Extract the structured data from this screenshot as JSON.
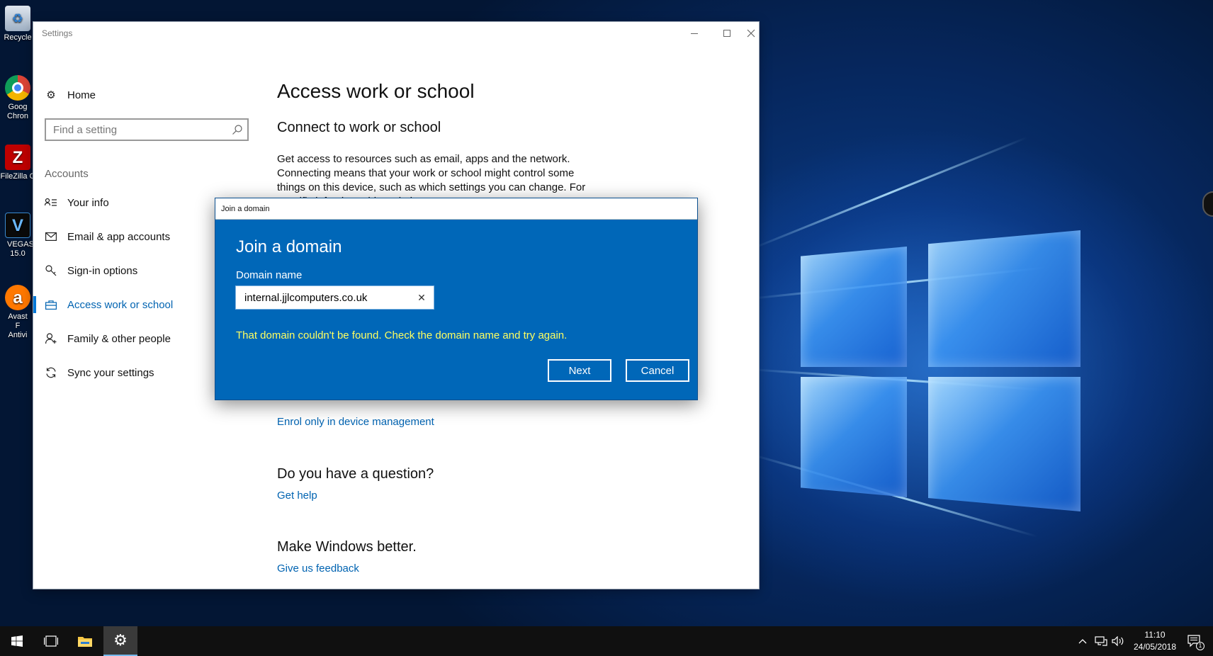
{
  "desktop": {
    "icons": [
      {
        "label": "Recycle",
        "icon": "recycle-bin-icon",
        "color": "#ffffff"
      },
      {
        "label": "Goog Chron",
        "icon": "chrome-icon",
        "color": "#4285f4"
      },
      {
        "label": "FileZilla C",
        "icon": "filezilla-icon",
        "color": "#bf0000"
      },
      {
        "label": "VEGAS 15.0",
        "icon": "vegas-icon",
        "color": "#0a0a0a"
      },
      {
        "label": "Avast F Antivi",
        "icon": "avast-icon",
        "color": "#ff7800"
      }
    ]
  },
  "settings": {
    "window_title": "Settings",
    "nav": {
      "home": "Home",
      "search_placeholder": "Find a setting",
      "section": "Accounts",
      "items": [
        {
          "label": "Your info",
          "icon": "person-card-icon"
        },
        {
          "label": "Email & app accounts",
          "icon": "mail-icon"
        },
        {
          "label": "Sign-in options",
          "icon": "key-icon"
        },
        {
          "label": "Access work or school",
          "icon": "briefcase-icon",
          "active": true
        },
        {
          "label": "Family & other people",
          "icon": "person-add-icon"
        },
        {
          "label": "Sync your settings",
          "icon": "sync-icon"
        }
      ]
    },
    "content": {
      "title": "Access work or school",
      "subtitle": "Connect to work or school",
      "description": "Get access to resources such as email, apps and the network. Connecting means that your work or school might control some things on this device, such as which settings you can change. For specific info about this, ask them.",
      "enrol_link": "Enrol only in device management",
      "question_heading": "Do you have a question?",
      "help_link": "Get help",
      "better_heading": "Make Windows better.",
      "feedback_link": "Give us feedback"
    }
  },
  "dialog": {
    "window_title": "Join a domain",
    "heading": "Join a domain",
    "field_label": "Domain name",
    "field_value": "internal.jjlcomputers.co.uk",
    "error": "That domain couldn't be found. Check the domain name and try again.",
    "next_label": "Next",
    "cancel_label": "Cancel",
    "accent": "#0067b8",
    "error_color": "#ffff60"
  },
  "taskbar": {
    "time": "11:10",
    "date": "24/05/2018",
    "notification_count": "1"
  }
}
